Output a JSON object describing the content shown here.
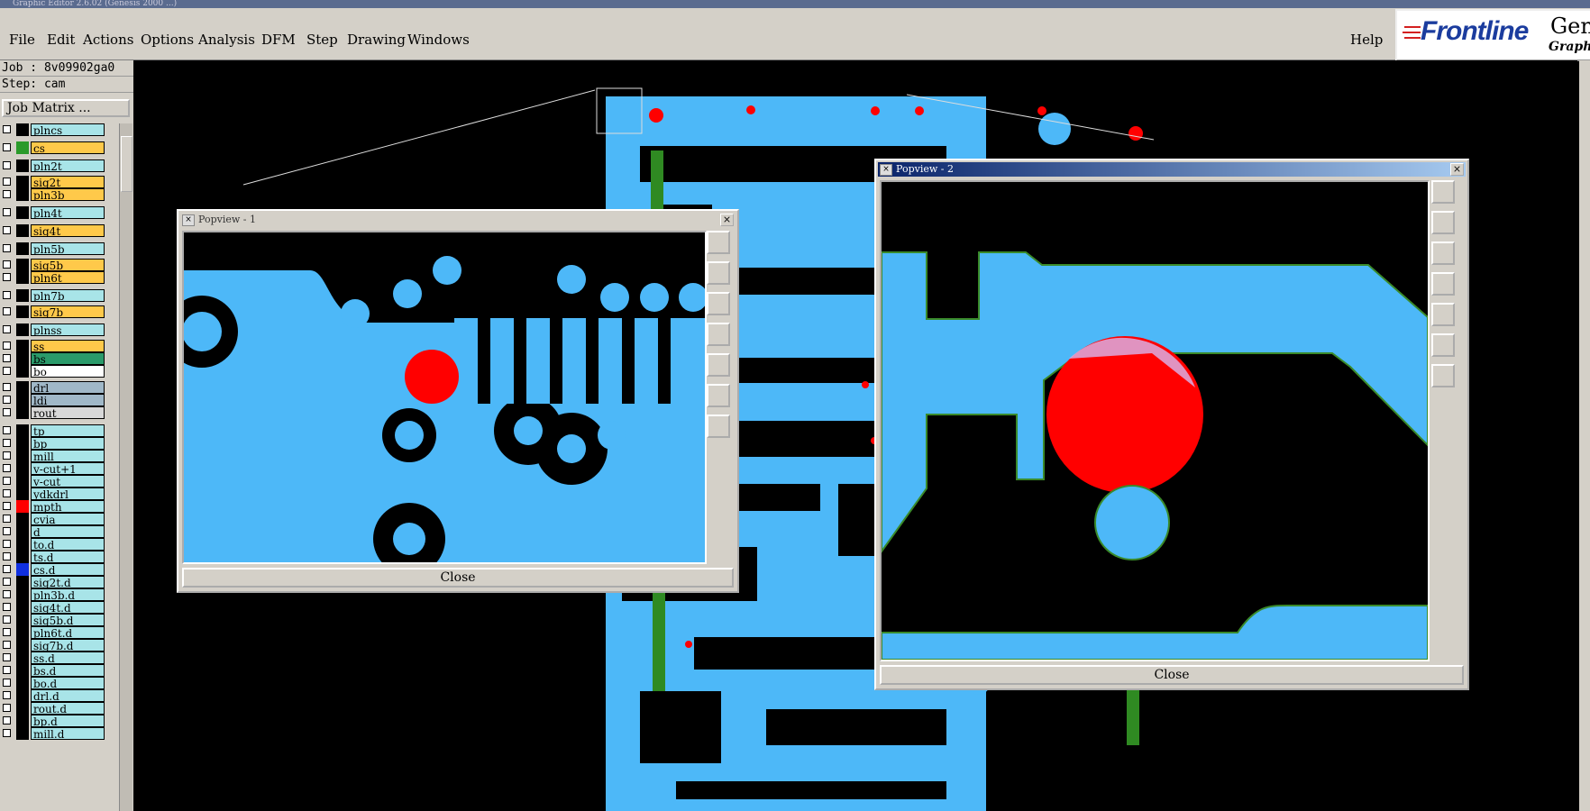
{
  "window": {
    "title": "Graphic Editor 2.6.02 (Genesis 2000 ...)"
  },
  "menu": {
    "items": [
      "File",
      "Edit",
      "Actions",
      "Options",
      "Analysis",
      "DFM",
      "Step",
      "Drawing",
      "Windows"
    ],
    "help": "Help"
  },
  "logo": {
    "brand": "Frontline",
    "product": "Genl",
    "sub": "Graphic"
  },
  "job": {
    "job_line": "Job : 8v09902ga0",
    "step_line": "Step: cam",
    "matrix_button": "Job Matrix ..."
  },
  "layers": [
    {
      "name": "plncs",
      "color": "#a8e4e8",
      "swatch": "#000"
    },
    {
      "name": "cs",
      "color": "#ffc94a",
      "swatch": "#2a9a2a"
    },
    {
      "name": "pln2t",
      "color": "#a8e4e8",
      "swatch": "#000"
    },
    {
      "name": "sig2t",
      "color": "#ffc94a",
      "swatch": "#000"
    },
    {
      "name": "pln3b",
      "color": "#ffc94a",
      "swatch": "#000"
    },
    {
      "name": "pln4t",
      "color": "#a8e4e8",
      "swatch": "#000"
    },
    {
      "name": "sig4t",
      "color": "#ffc94a",
      "swatch": "#000"
    },
    {
      "name": "pln5b",
      "color": "#a8e4e8",
      "swatch": "#000"
    },
    {
      "name": "sig5b",
      "color": "#ffc94a",
      "swatch": "#000"
    },
    {
      "name": "pln6t",
      "color": "#ffc94a",
      "swatch": "#000"
    },
    {
      "name": "pln7b",
      "color": "#a8e4e8",
      "swatch": "#000"
    },
    {
      "name": "sig7b",
      "color": "#ffc94a",
      "swatch": "#000"
    },
    {
      "name": "plnss",
      "color": "#a8e4e8",
      "swatch": "#000"
    },
    {
      "name": "ss",
      "color": "#ffc94a",
      "swatch": "#000"
    },
    {
      "name": "bs",
      "color": "#2a9a6a",
      "swatch": "#000"
    },
    {
      "name": "bo",
      "color": "#ffffff",
      "swatch": "#000"
    },
    {
      "name": "drl",
      "color": "#a0b8c8",
      "swatch": "#000"
    },
    {
      "name": "ldi",
      "color": "#a0b8c8",
      "swatch": "#000"
    },
    {
      "name": "rout",
      "color": "#d8d8d8",
      "swatch": "#000"
    },
    {
      "name": "tp",
      "color": "#a8e4e8",
      "swatch": "#000"
    },
    {
      "name": "bp",
      "color": "#a8e4e8",
      "swatch": "#000"
    },
    {
      "name": "mill",
      "color": "#a8e4e8",
      "swatch": "#000"
    },
    {
      "name": "v-cut+1",
      "color": "#a8e4e8",
      "swatch": "#000"
    },
    {
      "name": "v-cut",
      "color": "#a8e4e8",
      "swatch": "#000"
    },
    {
      "name": "ydkdrl",
      "color": "#a8e4e8",
      "swatch": "#000"
    },
    {
      "name": "mpth",
      "color": "#a8e4e8",
      "swatch": "#ff0000"
    },
    {
      "name": "cvia",
      "color": "#a8e4e8",
      "swatch": "#000"
    },
    {
      "name": "d",
      "color": "#a8e4e8",
      "swatch": "#000"
    },
    {
      "name": "to.d",
      "color": "#a8e4e8",
      "swatch": "#000"
    },
    {
      "name": "ts.d",
      "color": "#a8e4e8",
      "swatch": "#000"
    },
    {
      "name": "cs.d",
      "color": "#a8e4e8",
      "swatch": "#1030e0"
    },
    {
      "name": "sig2t.d",
      "color": "#a8e4e8",
      "swatch": "#000"
    },
    {
      "name": "pln3b.d",
      "color": "#a8e4e8",
      "swatch": "#000"
    },
    {
      "name": "sig4t.d",
      "color": "#a8e4e8",
      "swatch": "#000"
    },
    {
      "name": "sig5b.d",
      "color": "#a8e4e8",
      "swatch": "#000"
    },
    {
      "name": "pln6t.d",
      "color": "#a8e4e8",
      "swatch": "#000"
    },
    {
      "name": "sig7b.d",
      "color": "#a8e4e8",
      "swatch": "#000"
    },
    {
      "name": "ss.d",
      "color": "#a8e4e8",
      "swatch": "#000"
    },
    {
      "name": "bs.d",
      "color": "#a8e4e8",
      "swatch": "#000"
    },
    {
      "name": "bo.d",
      "color": "#a8e4e8",
      "swatch": "#000"
    },
    {
      "name": "drl.d",
      "color": "#a8e4e8",
      "swatch": "#000"
    },
    {
      "name": "rout.d",
      "color": "#a8e4e8",
      "swatch": "#000"
    },
    {
      "name": "bp.d",
      "color": "#a8e4e8",
      "swatch": "#000"
    },
    {
      "name": "mill.d",
      "color": "#a8e4e8",
      "swatch": "#000"
    }
  ],
  "popview1": {
    "title": "Popview - 1",
    "close": "Close"
  },
  "popview2": {
    "title": "Popview - 2",
    "close": "Close"
  },
  "colors": {
    "copper": "#4db8f8",
    "pad_red": "#ff0000",
    "board_bg": "#000000",
    "panel": "#d4d0c8"
  }
}
